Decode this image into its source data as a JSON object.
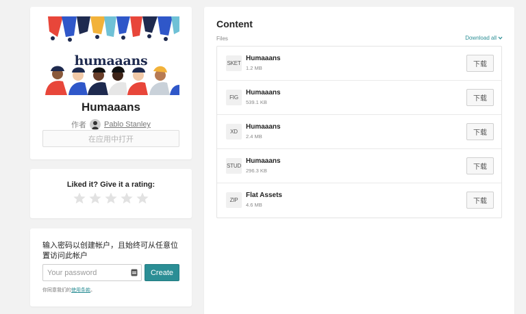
{
  "product": {
    "hero_wordmark": "humaaans",
    "title": "Humaaans",
    "author_prefix": "作者",
    "author_name": "Pablo Stanley",
    "open_in_app_label": "在应用中打开"
  },
  "rating": {
    "title": "Liked it? Give it a rating:",
    "max_stars": 5,
    "current": 0
  },
  "signup": {
    "description": "输入密码以创建帐户，且始终可从任意位置访问此帐户",
    "password_placeholder": "Your password",
    "create_label": "Create",
    "terms_prefix": "你同意我们的",
    "terms_link": "使用条款",
    "terms_suffix": "。"
  },
  "content": {
    "title": "Content",
    "files_label": "Files",
    "download_all_label": "Download all",
    "download_button_label": "下载",
    "files": [
      {
        "type": "SKET",
        "name": "Humaaans",
        "size": "1.2 MB"
      },
      {
        "type": "FIG",
        "name": "Humaaans",
        "size": "539.1 KB"
      },
      {
        "type": "XD",
        "name": "Humaaans",
        "size": "2.4 MB"
      },
      {
        "type": "STUD",
        "name": "Humaaans",
        "size": "296.3 KB"
      },
      {
        "type": "ZIP",
        "name": "Flat Assets",
        "size": "4.6 MB"
      }
    ]
  },
  "colors": {
    "accent": "#2b8e95",
    "page_background": "#f2f2f2",
    "star_empty": "#e2e2e2"
  }
}
